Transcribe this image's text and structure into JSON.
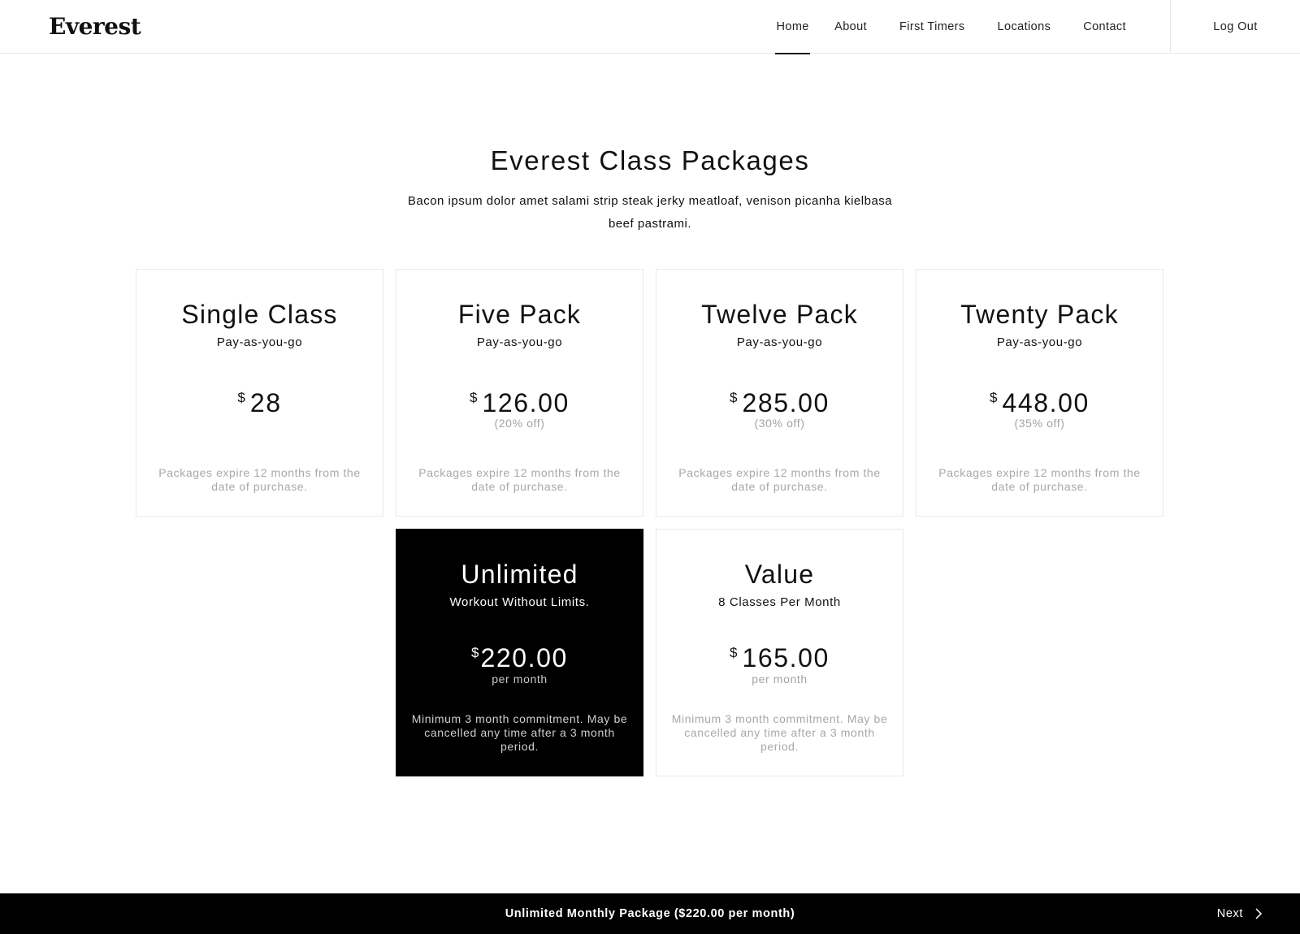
{
  "header": {
    "logo": "Everest",
    "nav": [
      {
        "label": "Home",
        "active": true
      },
      {
        "label": "About",
        "active": false
      },
      {
        "label": "First Timers",
        "active": false
      },
      {
        "label": "Locations",
        "active": false
      },
      {
        "label": "Contact",
        "active": false
      }
    ],
    "logout_label": "Log Out"
  },
  "intro": {
    "title": "Everest Class Packages",
    "subtitle": "Bacon ipsum dolor amet salami strip steak jerky meatloaf, venison picanha kielbasa beef pastrami."
  },
  "packages": [
    {
      "name": "Single Class",
      "tagline": "Pay-as-you-go",
      "currency": "$",
      "price": "28",
      "discount": "",
      "note": "Packages expire 12 months from the date of purchase.",
      "selected": false
    },
    {
      "name": "Five Pack",
      "tagline": "Pay-as-you-go",
      "currency": "$",
      "price": "126.00",
      "discount": "(20% off)",
      "note": "Packages expire 12 months from the date of purchase.",
      "selected": false
    },
    {
      "name": "Twelve Pack",
      "tagline": "Pay-as-you-go",
      "currency": "$",
      "price": "285.00",
      "discount": "(30% off)",
      "note": "Packages expire 12 months from the date of purchase.",
      "selected": false
    },
    {
      "name": "Twenty Pack",
      "tagline": "Pay-as-you-go",
      "currency": "$",
      "price": "448.00",
      "discount": "(35% off)",
      "note": "Packages expire 12 months from the date of purchase.",
      "selected": false
    },
    {
      "name": "Unlimited",
      "tagline": "Workout Without Limits.",
      "currency": "$",
      "price": "220.00",
      "discount": "per month",
      "note": "Minimum 3 month commitment. May be cancelled any time after a 3 month period.",
      "selected": true
    },
    {
      "name": "Value",
      "tagline": "8 Classes Per Month",
      "currency": "$",
      "price": "165.00",
      "discount": "per month",
      "note": "Minimum 3 month commitment. May be cancelled any time after a 3 month period.",
      "selected": false
    }
  ],
  "footer": {
    "summary": "Unlimited Monthly Package ($220.00 per month)",
    "next_label": "Next",
    "next_icon": "chevron-right-icon"
  },
  "colors": {
    "background": "#ffffff",
    "text": "#111111",
    "muted": "#a8a8a8",
    "selected_card": "#000000",
    "footer_bar": "#000000",
    "border": "#e9e9e9"
  }
}
